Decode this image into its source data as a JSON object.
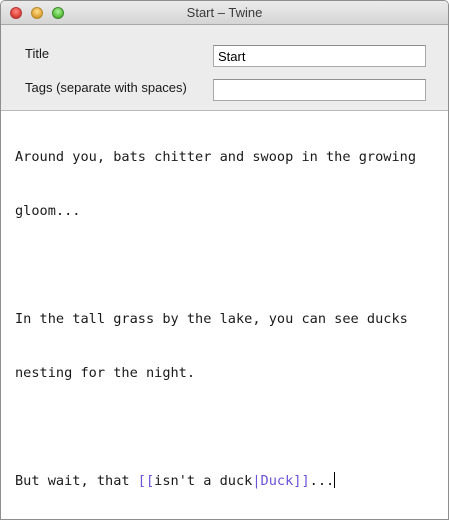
{
  "window": {
    "title": "Start – Twine"
  },
  "props": {
    "title_label": "Title",
    "title_value": "Start",
    "tags_label": "Tags (separate with spaces)",
    "tags_value": ""
  },
  "editor": {
    "line1": "Around you, bats chitter and swoop in the growing",
    "line2": "gloom...",
    "line3": "In the tall grass by the lake, you can see ducks",
    "line4": "nesting for the night.",
    "line5_prefix": "But wait, that ",
    "link_open": "[[",
    "link_text": "isn't a duck",
    "link_sep": "|",
    "link_target": "Duck",
    "link_close": "]]",
    "line5_suffix": "..."
  },
  "colors": {
    "link": "#6a52d8"
  }
}
